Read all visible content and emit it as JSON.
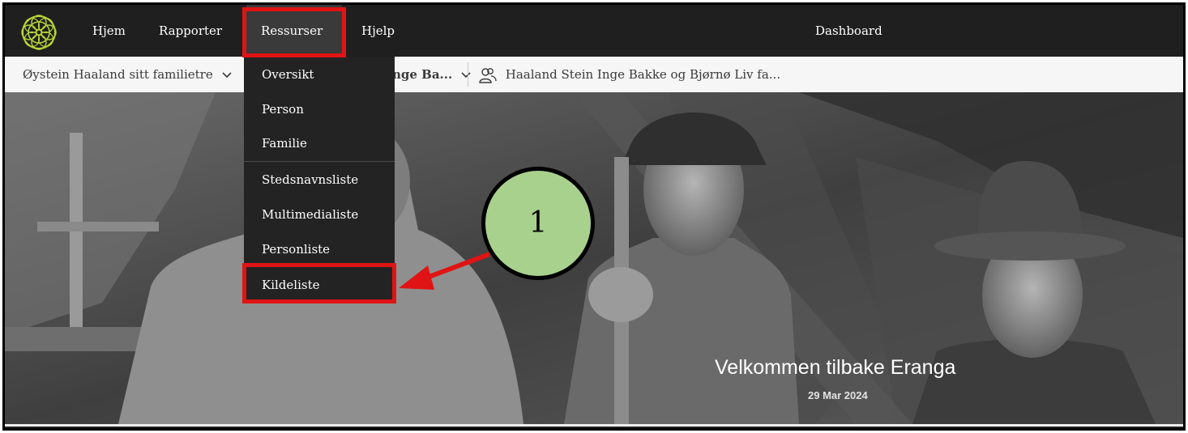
{
  "nav": {
    "items": [
      "Hjem",
      "Rapporter",
      "Ressurser",
      "Hjelp"
    ],
    "active": "Ressurser",
    "page_title": "Dashboard"
  },
  "subbar": {
    "tree": "Øystein Haaland sitt familietre",
    "person": "nge Ba...",
    "family": "Haaland Stein Inge Bakke og Bjørnø Liv fa..."
  },
  "dropdown": {
    "items": [
      "Oversikt",
      "Person",
      "Familie",
      "Stedsnavnsliste",
      "Multimedialiste",
      "Personliste",
      "Kildeliste"
    ],
    "highlighted": "Kildeliste"
  },
  "hero": {
    "welcome": "Velkommen tilbake Eranga",
    "date": "29 Mar 2024"
  },
  "annotation": {
    "step_number": "1",
    "highlight_color": "#e01414",
    "callout_color": "#a9d18e"
  },
  "icons": {
    "logo": "logo-icon",
    "chevron": "chevron-down-icon",
    "family": "people-icon"
  }
}
